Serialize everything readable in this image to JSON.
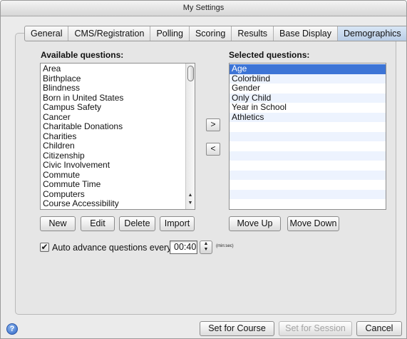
{
  "window": {
    "title": "My Settings"
  },
  "tabs": [
    {
      "label": "General"
    },
    {
      "label": "CMS/Registration"
    },
    {
      "label": "Polling"
    },
    {
      "label": "Scoring"
    },
    {
      "label": "Results"
    },
    {
      "label": "Base Display"
    },
    {
      "label": "Demographics",
      "active": true
    }
  ],
  "available": {
    "title": "Available questions:",
    "items": [
      "Area",
      "Birthplace",
      "Blindness",
      "Born in United States",
      "Campus Safety",
      "Cancer",
      "Charitable Donations",
      "Charities",
      "Children",
      "Citizenship",
      "Civic Involvement",
      "Commute",
      "Commute Time",
      "Computers",
      "Course Accessibility"
    ]
  },
  "selected": {
    "title": "Selected questions:",
    "items": [
      "Age",
      "Colorblind",
      "Gender",
      "Only Child",
      "Year in School",
      "Athletics"
    ],
    "selected_index": 0
  },
  "transfer": {
    "add": ">",
    "remove": "<"
  },
  "available_buttons": {
    "new": "New",
    "edit": "Edit",
    "delete": "Delete",
    "import": "Import"
  },
  "selected_buttons": {
    "move_up": "Move Up",
    "move_down": "Move Down"
  },
  "auto_advance": {
    "checked": true,
    "check_glyph": "✔",
    "label": "Auto advance questions every:",
    "value": "00:40",
    "unit": "(min:sec)"
  },
  "footer": {
    "help_glyph": "?",
    "set_for_course": "Set for Course",
    "set_for_session": "Set for Session",
    "cancel": "Cancel"
  },
  "colors": {
    "selection": "#3c74d6",
    "active_tab": "#c5d7ec",
    "stripe": "#edf3fe"
  },
  "icons": {
    "scroll_up": "▲",
    "scroll_down": "▼",
    "stepper_up": "▲",
    "stepper_down": "▼"
  }
}
